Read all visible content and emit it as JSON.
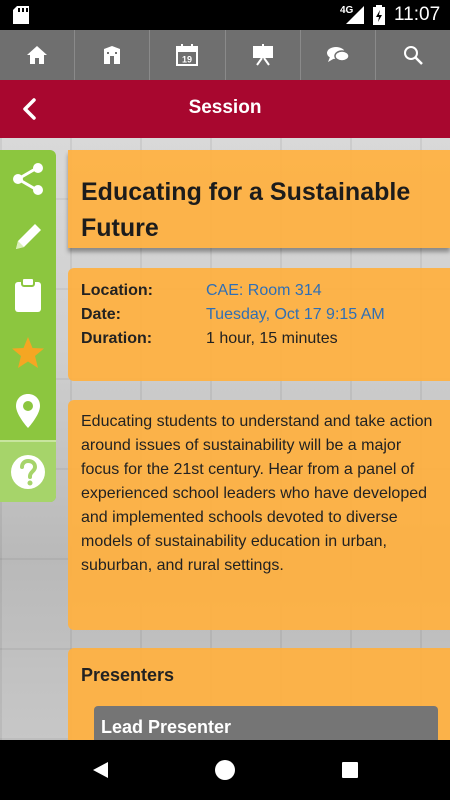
{
  "status_bar": {
    "time": "11:07",
    "network": "4G",
    "icons": [
      "sd-card-icon",
      "signal-icon",
      "battery-icon"
    ]
  },
  "top_nav": {
    "items": [
      {
        "name": "home-icon"
      },
      {
        "name": "building-icon"
      },
      {
        "name": "calendar-icon",
        "day": "19"
      },
      {
        "name": "presentation-icon"
      },
      {
        "name": "chat-icon"
      },
      {
        "name": "search-icon"
      }
    ]
  },
  "header": {
    "title": "Session",
    "back_icon": "chevron-left-icon"
  },
  "side_bar": {
    "items": [
      "share-icon",
      "pencil-icon",
      "clipboard-icon",
      "star-icon",
      "map-pin-icon",
      "help-icon"
    ]
  },
  "session": {
    "title": "Educating for a Sustainable Future",
    "location_label": "Location:",
    "location_value": "CAE: Room 314",
    "date_label": "Date:",
    "date_value": "Tuesday, Oct 17 9:15 AM",
    "duration_label": "Duration:",
    "duration_value": "1 hour, 15 minutes",
    "description": "Educating students to understand and take action around issues of sustainability will be a major focus for the 21st century. Hear from a panel of experienced school leaders who have developed and implemented schools devoted to diverse models of sustainability education in urban, suburban, and rural settings.",
    "presenters_heading": "Presenters",
    "lead_presenter_label": "Lead Presenter"
  },
  "android_nav": {
    "items": [
      "back-triangle-icon",
      "home-circle-icon",
      "recents-square-icon"
    ]
  },
  "colors": {
    "header_bg": "#a8072f",
    "top_nav_bg": "#6f6f6f",
    "side_bar_bg": "#8cc63f",
    "card_bg": "#ffb040",
    "link": "#2f6fb5",
    "star": "#f5a623"
  }
}
